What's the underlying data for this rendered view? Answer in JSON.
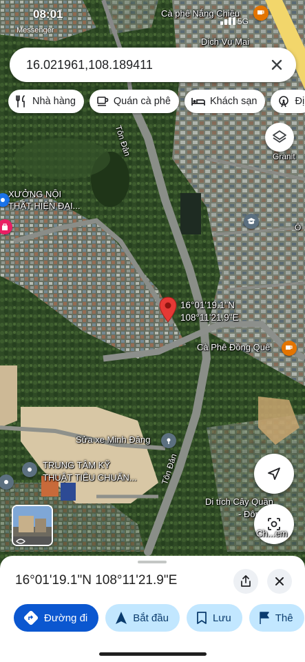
{
  "status_bar": {
    "time": "08:01",
    "app": "Messenger",
    "network": "5G"
  },
  "search": {
    "query": "16.021961,108.189411"
  },
  "chips": [
    {
      "label": "Nhà hàng",
      "icon": "fork-knife-icon"
    },
    {
      "label": "Quán cà phê",
      "icon": "coffee-cup-icon"
    },
    {
      "label": "Khách sạn",
      "icon": "bed-icon"
    },
    {
      "label": "Đị",
      "icon": "ferris-wheel-icon"
    }
  ],
  "map": {
    "pin_coords_line1": "16°01'19.1\"N",
    "pin_coords_line2": "108°11'21.9\"E",
    "places": {
      "ca_phe_nang_chieu": "Cà phê Nắng Chiều",
      "dich_vu_mai": "Dịch Vụ Mai",
      "xuong_noi_line1": "XƯỞNG NỘI",
      "xuong_noi_line2": "THẤT HIỆN ĐẠI...",
      "ca_phe_dong_que": "Cà Phê Đồng Quê",
      "sua_xe": "Sửa xe Minh Đăng",
      "trung_tam_line1": "TRUNG TÂM KỸ",
      "trung_tam_line2": "THUẬT TIÊU CHUẨN...",
      "di_tich_line1": "Di tích Cây Quần",
      "di_tich_line2": "- Đôn... ước",
      "granit": "Granit",
      "o": "Ô"
    },
    "roads": {
      "ton_dan_1": "Tôn Đản",
      "ton_dan_2": "Tôn Đản"
    },
    "lens_label": "Ch...em",
    "colors": {
      "pin": "#e53935",
      "accent_blue": "#0b57d0",
      "chip_bg": "#ffffff",
      "sec_btn": "#c2e7ff"
    }
  },
  "sheet": {
    "title": "16°01'19.1\"N 108°11'21.9\"E",
    "actions": [
      {
        "label": "Đường đi",
        "icon": "directions-icon"
      },
      {
        "label": "Bắt đầu",
        "icon": "navigation-arrow-icon"
      },
      {
        "label": "Lưu",
        "icon": "bookmark-icon"
      },
      {
        "label": "Thê",
        "icon": "flag-icon"
      }
    ]
  }
}
